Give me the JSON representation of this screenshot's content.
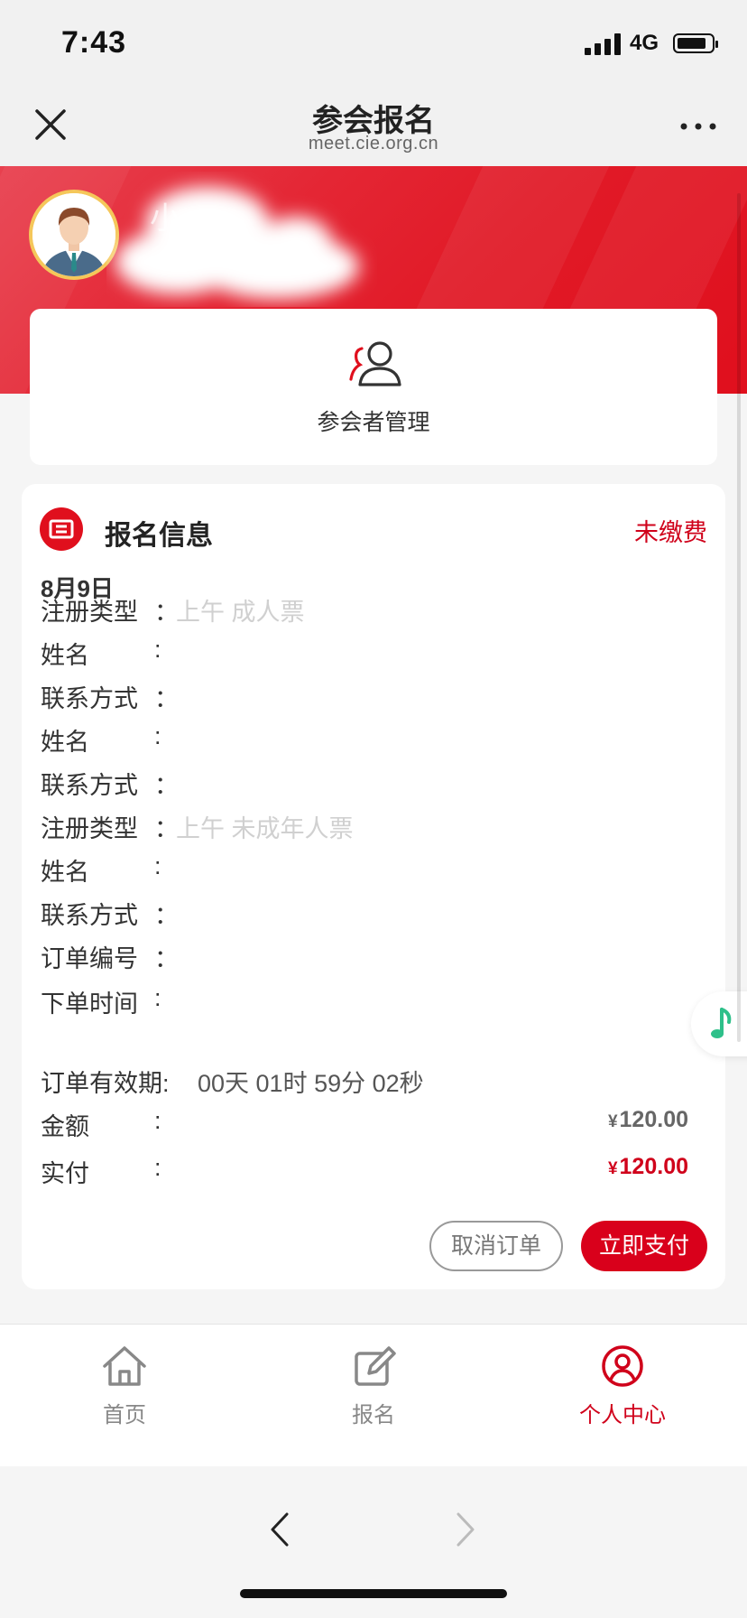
{
  "status_bar": {
    "time": "7:43",
    "network": "4G",
    "battery_level": 0.85,
    "signal_bars": 4
  },
  "nav": {
    "title": "参会报名",
    "url": "meet.cie.org.cn",
    "close_icon": "close-icon",
    "more_icon": "more-icon"
  },
  "profile": {
    "username": "小"
  },
  "participant_management": {
    "label": "参会者管理"
  },
  "registration": {
    "title": "报名信息",
    "status": "未缴费",
    "date": "8月9日",
    "rows": [
      {
        "label": "注册类型",
        "colon": "：",
        "value": "上午 成人票"
      },
      {
        "label": "姓名",
        "colon": ":",
        "value": ""
      },
      {
        "label": "联系方式",
        "colon": "：",
        "value": ""
      },
      {
        "label": "姓名",
        "colon": ":",
        "value": ""
      },
      {
        "label": "联系方式",
        "colon": "：",
        "value": ""
      },
      {
        "label": "注册类型",
        "colon": "：",
        "value": "上午 未成年人票"
      },
      {
        "label": "姓名",
        "colon": ":",
        "value": ""
      },
      {
        "label": "联系方式",
        "colon": "：",
        "value": ""
      },
      {
        "label": "订单编号",
        "colon": "：",
        "value": ""
      },
      {
        "label": "下单时间",
        "colon": ":",
        "value": ""
      }
    ],
    "validity_label": "订单有效期:",
    "countdown": "00天 01时 59分 02秒",
    "amount_label": "金额",
    "amount_currency": "¥",
    "amount_value": "120.00",
    "paid_label": "实付",
    "paid_currency": "¥",
    "paid_value": "120.00",
    "cancel_button": "取消订单",
    "pay_button": "立即支付"
  },
  "tabbar": {
    "items": [
      {
        "label": "首页",
        "icon": "home-icon",
        "active": false
      },
      {
        "label": "报名",
        "icon": "edit-icon",
        "active": false
      },
      {
        "label": "个人中心",
        "icon": "user-circle-icon",
        "active": true
      }
    ]
  },
  "colors": {
    "brand_red": "#e00f1d",
    "accent_red": "#d0021b",
    "inactive_gray": "#888888"
  }
}
